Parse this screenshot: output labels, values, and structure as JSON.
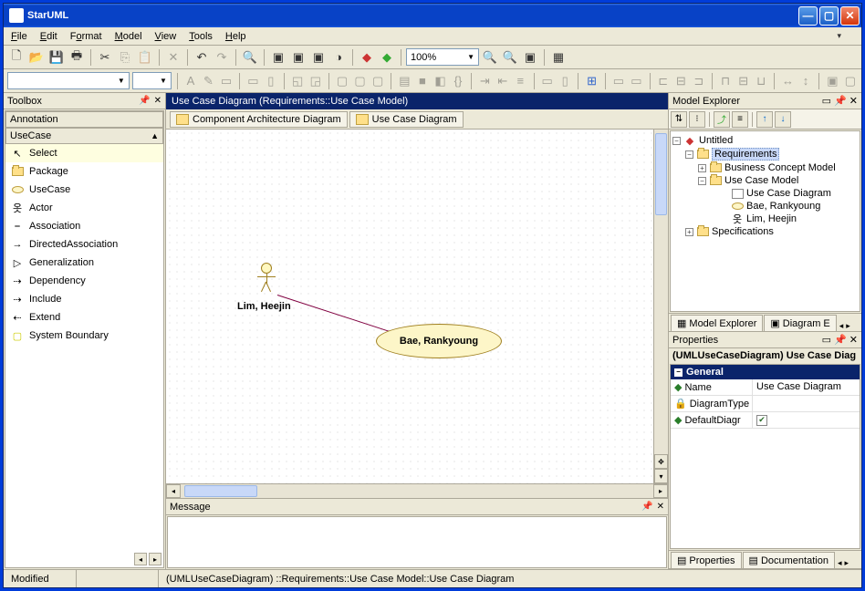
{
  "app": {
    "title": "StarUML"
  },
  "menu": {
    "file": "File",
    "edit": "Edit",
    "format": "Format",
    "model": "Model",
    "view": "View",
    "tools": "Tools",
    "help": "Help"
  },
  "toolbar": {
    "zoom": "100%"
  },
  "toolbox": {
    "title": "Toolbox",
    "cat_annotation": "Annotation",
    "cat_usecase": "UseCase",
    "items": {
      "select": "Select",
      "package": "Package",
      "usecase": "UseCase",
      "actor": "Actor",
      "association": "Association",
      "directed": "DirectedAssociation",
      "generalization": "Generalization",
      "dependency": "Dependency",
      "include": "Include",
      "extend": "Extend",
      "sysbound": "System Boundary"
    }
  },
  "diagram": {
    "title": "Use Case Diagram (Requirements::Use Case Model)",
    "tabs": {
      "comp": "Component Architecture Diagram",
      "uc": "Use Case Diagram"
    },
    "actor_label": "Lim, Heejin",
    "usecase_label": "Bae, Rankyoung"
  },
  "explorer": {
    "title": "Model Explorer",
    "root": "Untitled",
    "requirements": "Requirements",
    "bcm": "Business Concept Model",
    "ucm": "Use Case Model",
    "ucd": "Use Case Diagram",
    "uc_bae": "Bae, Rankyoung",
    "actor_lim": "Lim, Heejin",
    "specs": "Specifications",
    "tab_me": "Model Explorer",
    "tab_de": "Diagram E"
  },
  "properties": {
    "title": "Properties",
    "obj": "(UMLUseCaseDiagram) Use Case Diag",
    "cat_general": "General",
    "name_lbl": "Name",
    "name_val": "Use Case Diagram",
    "diagtype_lbl": "DiagramType",
    "defdiag_lbl": "DefaultDiagr",
    "tab_props": "Properties",
    "tab_doc": "Documentation"
  },
  "message": {
    "title": "Message"
  },
  "status": {
    "modified": "Modified",
    "path": "(UMLUseCaseDiagram) ::Requirements::Use Case Model::Use Case Diagram"
  }
}
